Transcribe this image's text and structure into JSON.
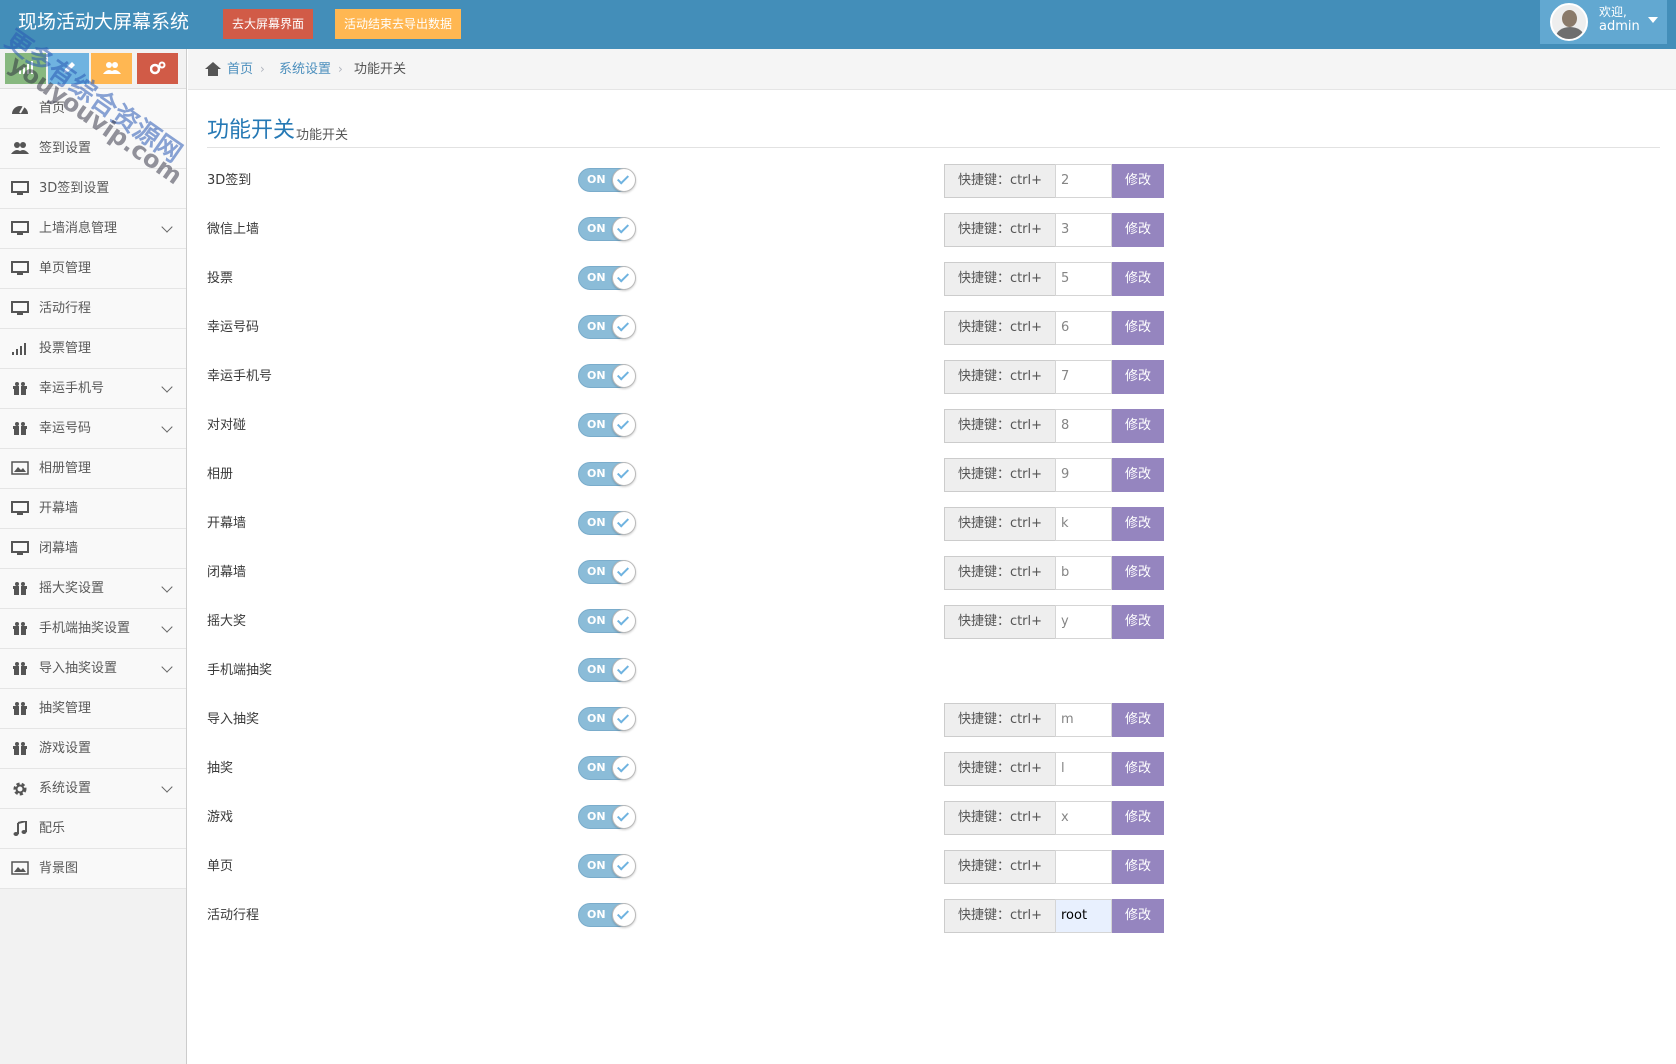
{
  "header": {
    "brand": "现场活动大屏幕系统",
    "btn_big_screen": "去大屏幕界面",
    "btn_export": "活动结束去导出数据",
    "welcome": "欢迎,",
    "username": "admin"
  },
  "sidebar": {
    "shortcut_icons": [
      "signal-icon",
      "pencil-icon",
      "users-icon",
      "cogs-icon"
    ],
    "items": [
      {
        "label": "首页",
        "icon": "dashboard-icon",
        "has_sub": false
      },
      {
        "label": "签到设置",
        "icon": "users-icon",
        "has_sub": false
      },
      {
        "label": "3D签到设置",
        "icon": "desktop-icon",
        "has_sub": false
      },
      {
        "label": "上墙消息管理",
        "icon": "desktop-icon",
        "has_sub": true
      },
      {
        "label": "单页管理",
        "icon": "desktop-icon",
        "has_sub": false
      },
      {
        "label": "活动行程",
        "icon": "desktop-icon",
        "has_sub": false
      },
      {
        "label": "投票管理",
        "icon": "signal-icon",
        "has_sub": false
      },
      {
        "label": "幸运手机号",
        "icon": "gift-icon",
        "has_sub": true
      },
      {
        "label": "幸运号码",
        "icon": "gift-icon",
        "has_sub": true
      },
      {
        "label": "相册管理",
        "icon": "picture-icon",
        "has_sub": false
      },
      {
        "label": "开幕墙",
        "icon": "desktop-icon",
        "has_sub": false
      },
      {
        "label": "闭幕墙",
        "icon": "desktop-icon",
        "has_sub": false
      },
      {
        "label": "摇大奖设置",
        "icon": "gift-icon",
        "has_sub": true
      },
      {
        "label": "手机端抽奖设置",
        "icon": "gift-icon",
        "has_sub": true
      },
      {
        "label": "导入抽奖设置",
        "icon": "gift-icon",
        "has_sub": true
      },
      {
        "label": "抽奖管理",
        "icon": "gift-icon",
        "has_sub": false
      },
      {
        "label": "游戏设置",
        "icon": "gift-icon",
        "has_sub": false
      },
      {
        "label": "系统设置",
        "icon": "cog-icon",
        "has_sub": true
      },
      {
        "label": "配乐",
        "icon": "music-icon",
        "has_sub": false
      },
      {
        "label": "背景图",
        "icon": "picture-icon",
        "has_sub": false
      }
    ]
  },
  "breadcrumb": {
    "home": "首页",
    "settings": "系统设置",
    "current": "功能开关"
  },
  "page": {
    "title": "功能开关",
    "subtitle": "功能开关"
  },
  "switch_on_label": "ON",
  "hotkey_prefix": "快捷键：ctrl+",
  "edit_label": "修改",
  "features": [
    {
      "label": "3D签到",
      "on": true,
      "hotkey": "2",
      "has_hotkey": true
    },
    {
      "label": "微信上墙",
      "on": true,
      "hotkey": "3",
      "has_hotkey": true
    },
    {
      "label": "投票",
      "on": true,
      "hotkey": "5",
      "has_hotkey": true
    },
    {
      "label": "幸运号码",
      "on": true,
      "hotkey": "6",
      "has_hotkey": true
    },
    {
      "label": "幸运手机号",
      "on": true,
      "hotkey": "7",
      "has_hotkey": true
    },
    {
      "label": "对对碰",
      "on": true,
      "hotkey": "8",
      "has_hotkey": true
    },
    {
      "label": "相册",
      "on": true,
      "hotkey": "9",
      "has_hotkey": true
    },
    {
      "label": "开幕墙",
      "on": true,
      "hotkey": "k",
      "has_hotkey": true
    },
    {
      "label": "闭幕墙",
      "on": true,
      "hotkey": "b",
      "has_hotkey": true
    },
    {
      "label": "摇大奖",
      "on": true,
      "hotkey": "y",
      "has_hotkey": true
    },
    {
      "label": "手机端抽奖",
      "on": true,
      "hotkey": "",
      "has_hotkey": false
    },
    {
      "label": "导入抽奖",
      "on": true,
      "hotkey": "m",
      "has_hotkey": true
    },
    {
      "label": "抽奖",
      "on": true,
      "hotkey": "l",
      "has_hotkey": true
    },
    {
      "label": "游戏",
      "on": true,
      "hotkey": "x",
      "has_hotkey": true
    },
    {
      "label": "单页",
      "on": true,
      "hotkey": "",
      "has_hotkey": true
    },
    {
      "label": "活动行程",
      "on": true,
      "hotkey": "root",
      "has_hotkey": true
    }
  ],
  "watermark": {
    "line1": "更多有综合资源网",
    "line2": "youyouvip.com"
  },
  "colors": {
    "navbar": "#438eb9",
    "btn_red": "#d15b47",
    "btn_orange": "#ffb752",
    "edit_btn": "#9585bf",
    "toggle_on": "#8bbcd8",
    "title_blue": "#2679b5"
  }
}
